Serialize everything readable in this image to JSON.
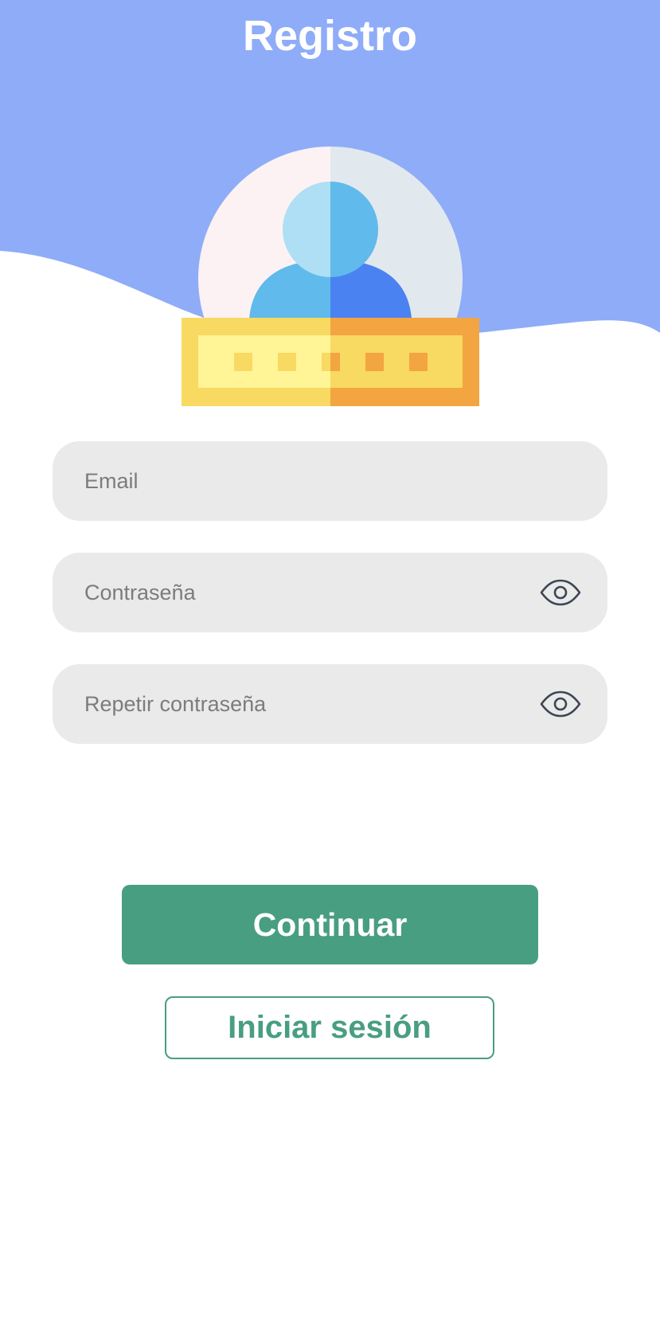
{
  "header": {
    "title": "Registro",
    "background_color": "#8facf8"
  },
  "illustration": {
    "icon": "user-password-icon",
    "colors": {
      "circle_left": "#fcf2f4",
      "circle_right": "#e1e9ee",
      "head_left": "#aedff5",
      "head_right": "#60baec",
      "body_left": "#60baec",
      "body_right": "#4a82f2",
      "bar_left": "#f8d962",
      "bar_right": "#f2a540",
      "bar_inner_left": "#fff597",
      "bar_inner_right": "#f8d962"
    }
  },
  "form": {
    "email": {
      "placeholder": "Email",
      "value": ""
    },
    "password": {
      "placeholder": "Contraseña",
      "value": "",
      "toggle_icon": "eye-icon"
    },
    "repeat_password": {
      "placeholder": "Repetir contraseña",
      "value": "",
      "toggle_icon": "eye-icon"
    }
  },
  "actions": {
    "continue_label": "Continuar",
    "login_label": "Iniciar sesión",
    "accent_color": "#489e80"
  }
}
